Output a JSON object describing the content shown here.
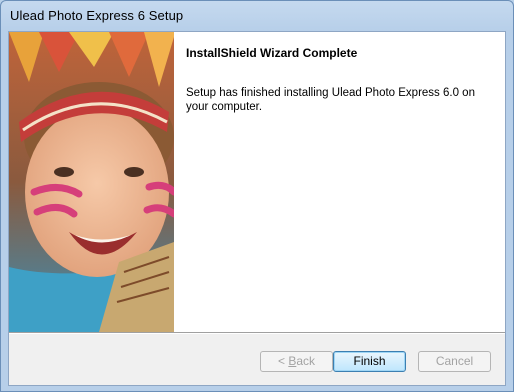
{
  "window": {
    "title": "Ulead Photo Express 6 Setup"
  },
  "content": {
    "heading": "InstallShield Wizard Complete",
    "message": "Setup has finished installing Ulead Photo Express 6.0 on your computer."
  },
  "buttons": {
    "back": {
      "mnemonic": "B",
      "rest": "ack",
      "enabled": false
    },
    "finish": {
      "label": "Finish",
      "default": true
    },
    "cancel": {
      "label": "Cancel",
      "enabled": false
    }
  },
  "side_image": {
    "subject": "smiling child with feather headdress and face paint"
  }
}
